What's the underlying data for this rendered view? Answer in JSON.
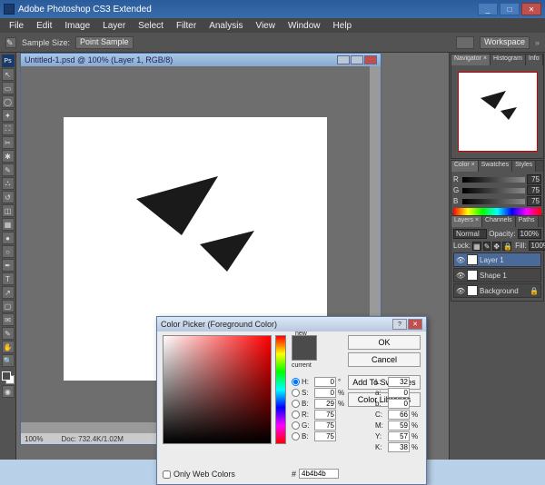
{
  "window": {
    "title": "Adobe Photoshop CS3 Extended"
  },
  "menu": {
    "items": [
      "File",
      "Edit",
      "Image",
      "Layer",
      "Select",
      "Filter",
      "Analysis",
      "View",
      "Window",
      "Help"
    ]
  },
  "options": {
    "sample_label": "Sample Size:",
    "sample_value": "Point Sample",
    "workspace": "Workspace"
  },
  "doc": {
    "title": "Untitled-1.psd @ 100% (Layer 1, RGB/8)",
    "zoom": "100%",
    "docsize": "Doc: 732.4K/1.02M"
  },
  "navigator": {
    "tabs": [
      "Navigator ×",
      "Histogram",
      "Info"
    ]
  },
  "color": {
    "tabs": [
      "Color ×",
      "Swatches",
      "Styles"
    ],
    "r": "75",
    "g": "75",
    "b": "75"
  },
  "layers": {
    "tabs": [
      "Layers ×",
      "Channels",
      "Paths"
    ],
    "blend": "Normal",
    "opacity_label": "Opacity:",
    "opacity": "100%",
    "lock_label": "Lock:",
    "fill_label": "Fill:",
    "fill": "100%",
    "rows": [
      {
        "name": "Layer 1"
      },
      {
        "name": "Shape 1"
      },
      {
        "name": "Background"
      }
    ]
  },
  "picker": {
    "title": "Color Picker (Foreground Color)",
    "new_label": "new",
    "current_label": "current",
    "buttons": {
      "ok": "OK",
      "cancel": "Cancel",
      "add": "Add To Swatches",
      "lib": "Color Libraries"
    },
    "hsb": {
      "h": "0",
      "s": "0",
      "b": "29"
    },
    "rgb": {
      "r": "75",
      "g": "75",
      "b": "75"
    },
    "lab": {
      "l": "32",
      "a": "0",
      "b2": "0"
    },
    "cmyk": {
      "c": "66",
      "m": "59",
      "y": "57",
      "k": "38"
    },
    "hex_label": "#",
    "hex": "4b4b4b",
    "web": "Only Web Colors",
    "unit_deg": "°",
    "unit_pct": "%"
  }
}
